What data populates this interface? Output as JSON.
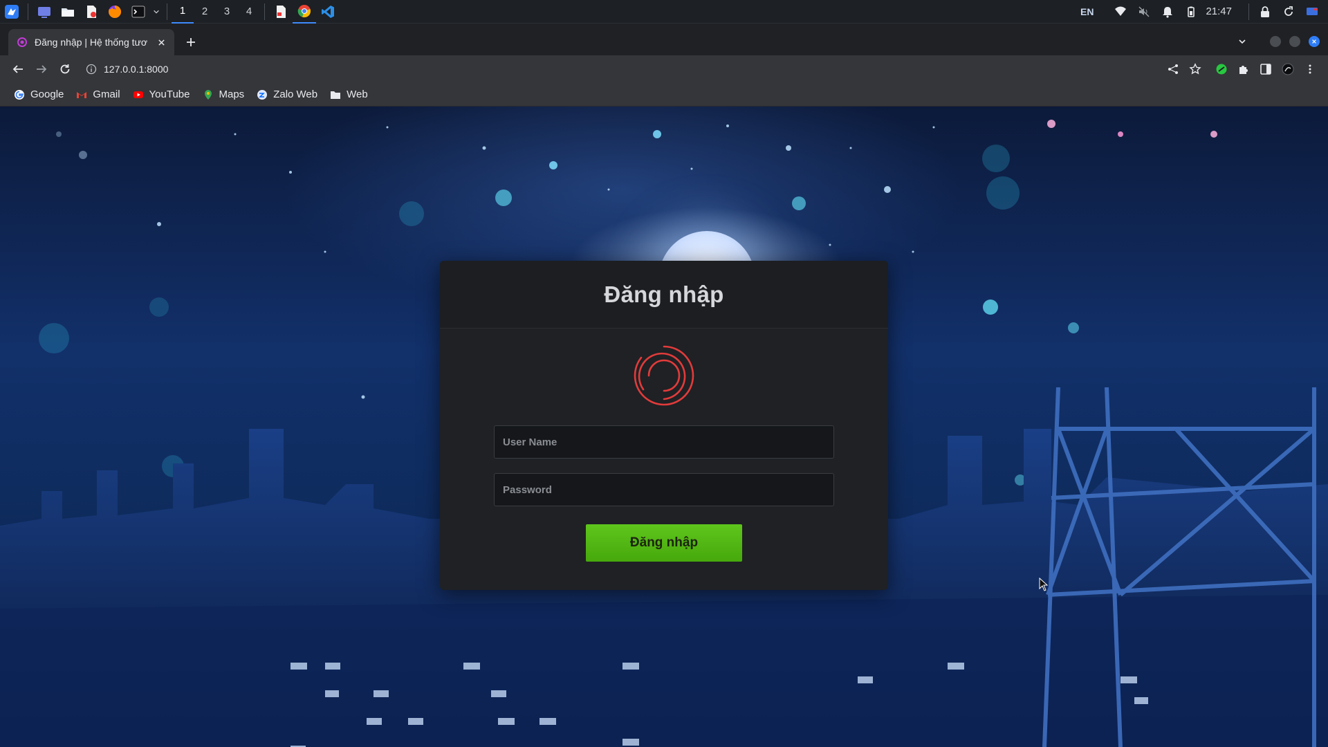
{
  "taskbar": {
    "workspaces": [
      "1",
      "2",
      "3",
      "4"
    ],
    "active_workspace": "1",
    "language": "EN",
    "clock": "21:47"
  },
  "browser": {
    "tab_title": "Đăng nhập | Hệ thống tươ",
    "url": "127.0.0.1:8000",
    "bookmarks": [
      {
        "label": "Google",
        "icon": "google-icon"
      },
      {
        "label": "Gmail",
        "icon": "gmail-icon"
      },
      {
        "label": "YouTube",
        "icon": "youtube-icon"
      },
      {
        "label": "Maps",
        "icon": "maps-icon"
      },
      {
        "label": "Zalo Web",
        "icon": "zalo-icon"
      },
      {
        "label": "Web",
        "icon": "folder-icon"
      }
    ]
  },
  "login": {
    "title": "Đăng nhập",
    "username_placeholder": "User Name",
    "password_placeholder": "Password",
    "submit_label": "Đăng nhập"
  },
  "colors": {
    "submit_green": "#52b814",
    "logo_red": "#e23b3b",
    "card_bg": "#1f2124"
  }
}
